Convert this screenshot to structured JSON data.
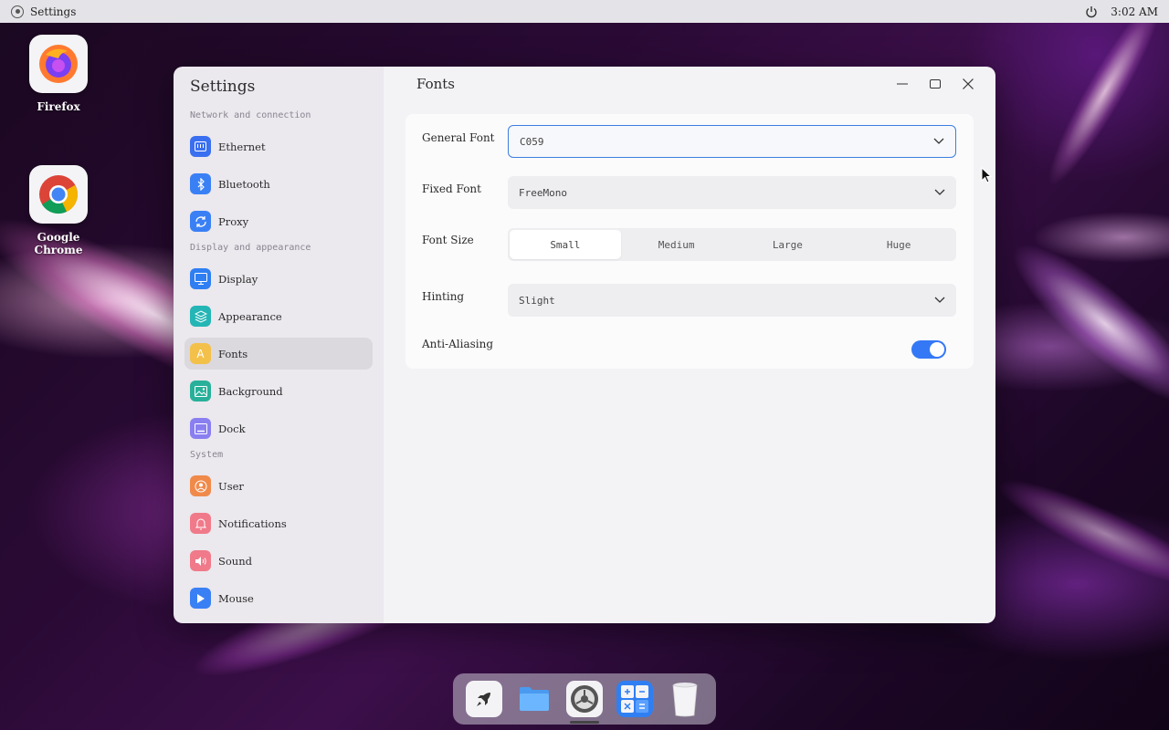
{
  "topbar": {
    "app_name": "Settings",
    "clock": "3:02 AM"
  },
  "desktop": {
    "icons": [
      {
        "label": "Firefox",
        "icon": "firefox-icon"
      },
      {
        "label": "Google Chrome",
        "icon": "chrome-icon"
      }
    ]
  },
  "sidebar": {
    "title": "Settings",
    "sections": [
      {
        "label": "Network and connection",
        "items": [
          {
            "label": "Ethernet",
            "icon": "ethernet-icon",
            "color": "#3a6ff0"
          },
          {
            "label": "Bluetooth",
            "icon": "bluetooth-icon",
            "color": "#3a80f5"
          },
          {
            "label": "Proxy",
            "icon": "proxy-icon",
            "color": "#3a80f5"
          }
        ]
      },
      {
        "label": "Display and appearance",
        "items": [
          {
            "label": "Display",
            "icon": "display-icon",
            "color": "#2f7ff2"
          },
          {
            "label": "Appearance",
            "icon": "appearance-icon",
            "color": "#24b5b5"
          },
          {
            "label": "Fonts",
            "icon": "fonts-icon",
            "color": "#f3c04a",
            "active": true
          },
          {
            "label": "Background",
            "icon": "background-icon",
            "color": "#28b09a"
          },
          {
            "label": "Dock",
            "icon": "dock-icon",
            "color": "#8a7ff0"
          }
        ]
      },
      {
        "label": "System",
        "items": [
          {
            "label": "User",
            "icon": "user-icon",
            "color": "#f08a4b"
          },
          {
            "label": "Notifications",
            "icon": "notifications-icon",
            "color": "#f07a8a"
          },
          {
            "label": "Sound",
            "icon": "sound-icon",
            "color": "#f07a8a"
          },
          {
            "label": "Mouse",
            "icon": "mouse-icon",
            "color": "#3a80f5"
          }
        ]
      }
    ]
  },
  "main": {
    "title": "Fonts",
    "general_font": {
      "label": "General Font",
      "value": "C059"
    },
    "fixed_font": {
      "label": "Fixed Font",
      "value": "FreeMono"
    },
    "font_size": {
      "label": "Font Size",
      "options": [
        "Small",
        "Medium",
        "Large",
        "Huge"
      ],
      "selected": "Small"
    },
    "hinting": {
      "label": "Hinting",
      "value": "Slight"
    },
    "anti_aliasing": {
      "label": "Anti-Aliasing",
      "enabled": true
    }
  },
  "dock": {
    "items": [
      {
        "name": "launcher-icon"
      },
      {
        "name": "files-icon"
      },
      {
        "name": "settings-icon"
      },
      {
        "name": "calculator-icon"
      },
      {
        "name": "trash-icon"
      }
    ]
  },
  "colors": {
    "accent": "#3478f6",
    "sidebar_bg": "#ebe8ee",
    "main_bg": "#f3f3f6"
  }
}
